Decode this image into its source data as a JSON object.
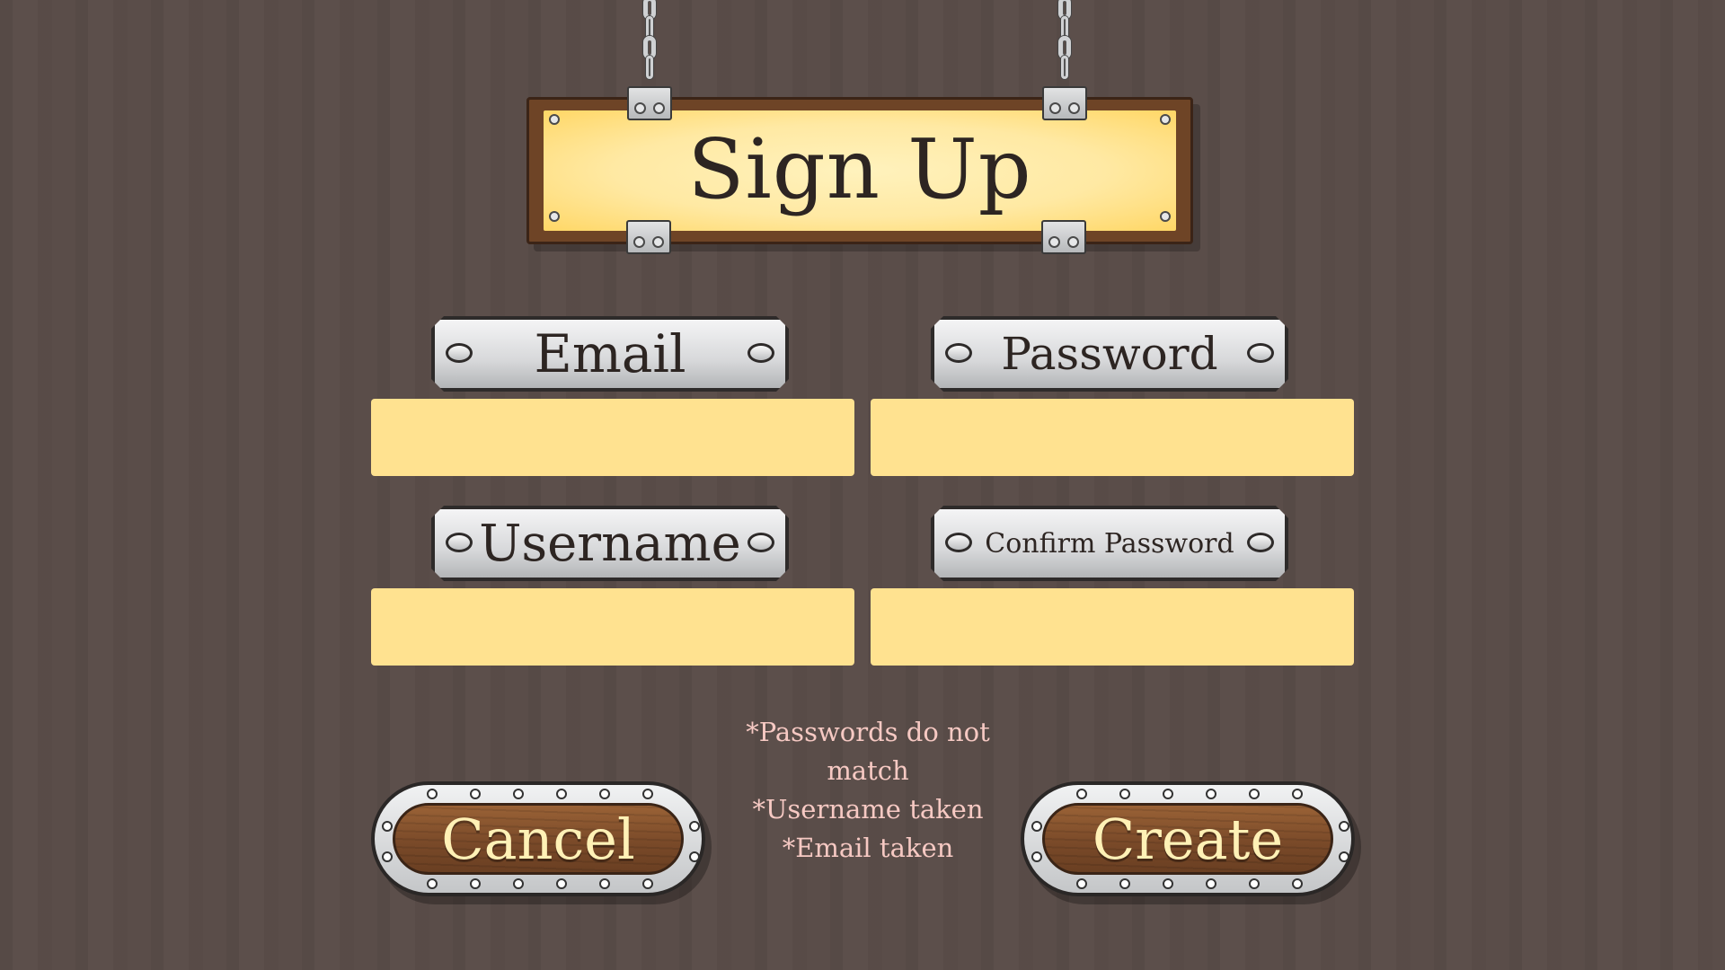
{
  "title": "Sign Up",
  "fields": {
    "email_label": "Email",
    "password_label": "Password",
    "username_label": "Username",
    "confirm_password_label": "Confirm Password",
    "email_value": "",
    "password_value": "",
    "username_value": "",
    "confirm_password_value": ""
  },
  "errors": {
    "passwords_mismatch": "*Passwords do not match",
    "username_taken": "*Username taken",
    "email_taken": "*Email taken"
  },
  "buttons": {
    "cancel_label": "Cancel",
    "create_label": "Create"
  },
  "colors": {
    "background": "#5a4d49",
    "input_fill": "#ffe290",
    "error_text": "#f6c9c3",
    "button_text": "#fff1b6",
    "title_text": "#2d2522"
  },
  "icons": [
    "chain-icon",
    "rivet-icon",
    "screw-icon"
  ]
}
